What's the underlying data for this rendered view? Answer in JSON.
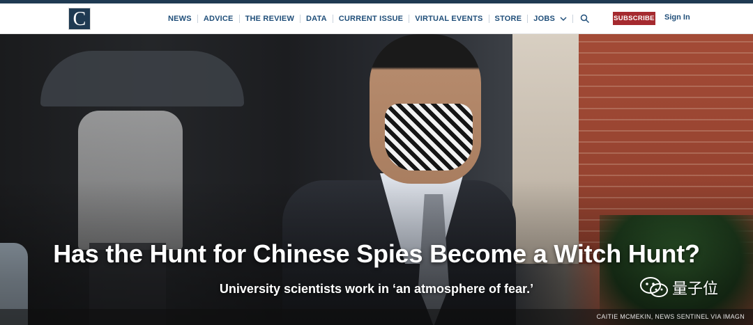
{
  "header": {
    "logo_letter": "C",
    "nav": [
      {
        "label": "NEWS"
      },
      {
        "label": "ADVICE"
      },
      {
        "label": "THE REVIEW"
      },
      {
        "label": "DATA"
      },
      {
        "label": "CURRENT ISSUE"
      },
      {
        "label": "VIRTUAL EVENTS"
      },
      {
        "label": "STORE"
      },
      {
        "label": "JOBS"
      }
    ],
    "subscribe_label": "SUBSCRIBE",
    "signin_label": "Sign In",
    "icons": [
      "chevron-down-icon",
      "search-icon"
    ]
  },
  "hero": {
    "headline": "Has the Hunt for Chinese Spies Become a Witch Hunt?",
    "dek": "University scientists work in ‘an atmosphere of fear.’",
    "photo_credit": "CAITIE MCMEKIN, NEWS SENTINEL VIA IMAGN",
    "watermark_text": "量子位"
  },
  "colors": {
    "brand_navy": "#1f3a52",
    "nav_text": "#1f4e79",
    "subscribe_red": "#a52a2f"
  }
}
